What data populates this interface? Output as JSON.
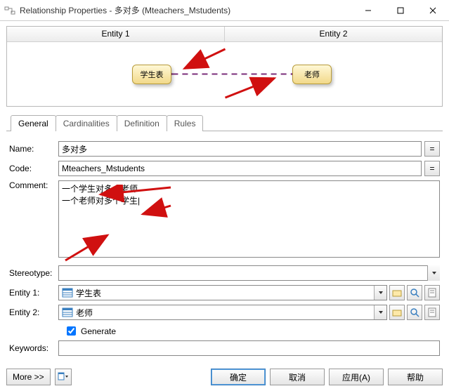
{
  "window": {
    "title": "Relationship Properties - 多对多 (Mteachers_Mstudents)"
  },
  "diagram": {
    "entity1_header": "Entity 1",
    "entity2_header": "Entity 2",
    "entity1_label": "学生表",
    "entity2_label": "老师"
  },
  "tabs": {
    "general": "General",
    "cardinalities": "Cardinalities",
    "definition": "Definition",
    "rules": "Rules"
  },
  "form": {
    "name_label": "Name:",
    "name_value": "多对多",
    "code_label": "Code:",
    "code_value": "Mteachers_Mstudents",
    "comment_label": "Comment:",
    "comment_value": "一个学生对多个老师\n一个老师对多个学生|",
    "stereotype_label": "Stereotype:",
    "stereotype_value": "",
    "entity1_label": "Entity 1:",
    "entity1_value": "学生表",
    "entity2_label": "Entity 2:",
    "entity2_value": "老师",
    "generate_label": "Generate",
    "keywords_label": "Keywords:",
    "keywords_value": "",
    "eq_symbol": "="
  },
  "footer": {
    "more": "More >>",
    "ok": "确定",
    "cancel": "取消",
    "apply": "应用(A)",
    "help": "帮助"
  }
}
